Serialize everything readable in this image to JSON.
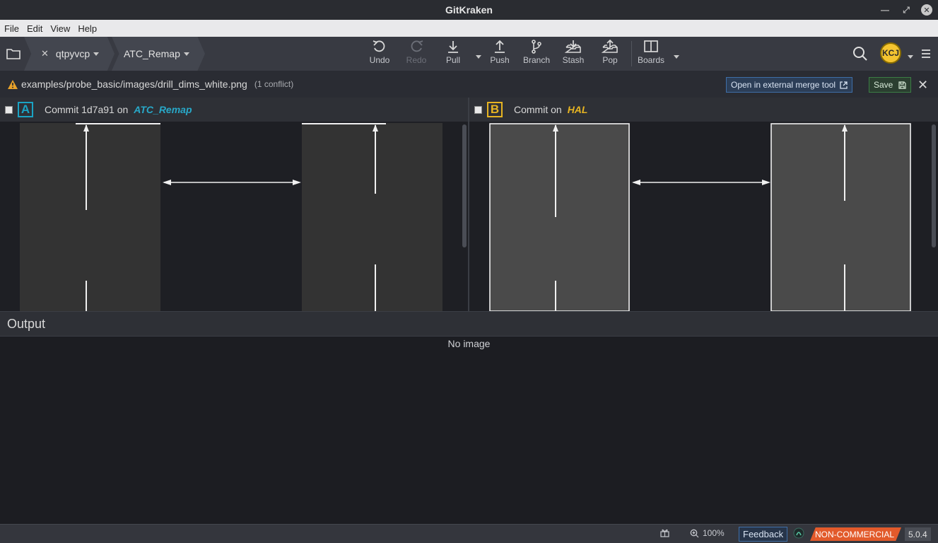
{
  "window": {
    "title": "GitKraken"
  },
  "menu": [
    "File",
    "Edit",
    "View",
    "Help"
  ],
  "tabs": {
    "repo": "qtpyvcp",
    "branch": "ATC_Remap"
  },
  "toolbar": {
    "undo": "Undo",
    "redo": "Redo",
    "pull": "Pull",
    "push": "Push",
    "branch": "Branch",
    "stash": "Stash",
    "pop": "Pop",
    "boards": "Boards"
  },
  "user": {
    "initials": "KCJ"
  },
  "conflict": {
    "path": "examples/probe_basic/images/drill_dims_white.png",
    "count_label": "(1 conflict)",
    "external_tool": "Open in external merge tool",
    "save": "Save"
  },
  "pane_a": {
    "letter": "A",
    "prefix": "Commit 1d7a91  on",
    "branch": "ATC_Remap"
  },
  "pane_b": {
    "letter": "B",
    "prefix": "Commit on",
    "branch": "HAL"
  },
  "output": {
    "title": "Output",
    "empty": "No image"
  },
  "status": {
    "zoom": "100%",
    "feedback": "Feedback",
    "license": "NON-COMMERCIAL",
    "version": "5.0.4"
  },
  "colors": {
    "accent_a": "#1aa3c4",
    "accent_b": "#e6b422",
    "license": "#e25a2b"
  }
}
